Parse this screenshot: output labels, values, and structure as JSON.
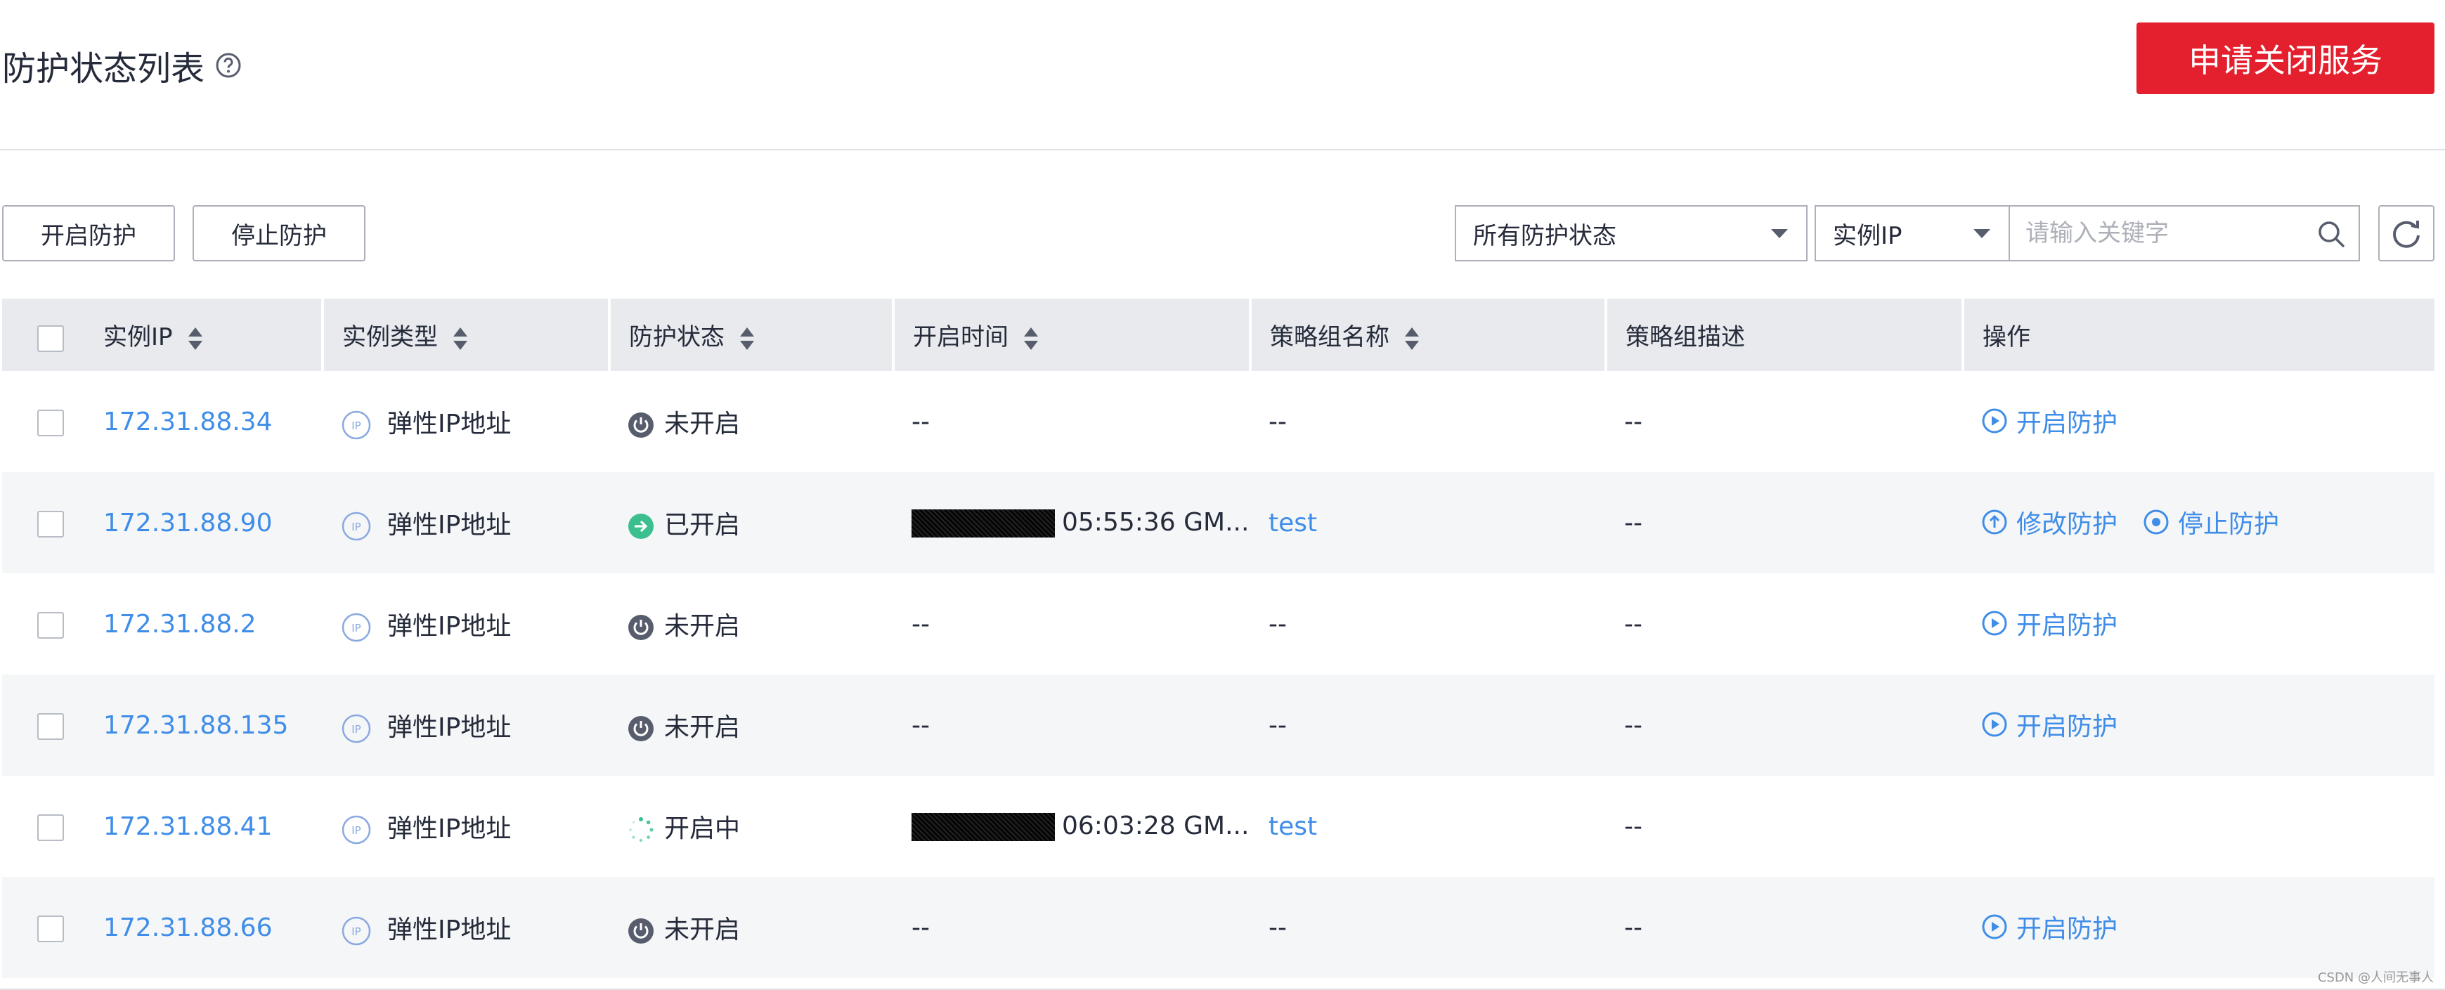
{
  "header": {
    "title": "防护状态列表",
    "close_service_label": "申请关闭服务"
  },
  "toolbar": {
    "start_label": "开启防护",
    "stop_label": "停止防护",
    "status_filter": "所有防护状态",
    "search_field": "实例IP",
    "search_placeholder": "请输入关键字"
  },
  "table": {
    "columns": [
      "实例IP",
      "实例类型",
      "防护状态",
      "开启时间",
      "策略组名称",
      "策略组描述",
      "操作"
    ],
    "rows": [
      {
        "ip": "172.31.88.34",
        "type": "弹性IP地址",
        "status": "未开启",
        "status_kind": "off",
        "time": "--",
        "policy": "--",
        "desc": "--",
        "ops": [
          "开启防护"
        ]
      },
      {
        "ip": "172.31.88.90",
        "type": "弹性IP地址",
        "status": "已开启",
        "status_kind": "on",
        "time": "05:55:36 GM...",
        "policy": "test",
        "desc": "--",
        "ops": [
          "修改防护",
          "停止防护"
        ]
      },
      {
        "ip": "172.31.88.2",
        "type": "弹性IP地址",
        "status": "未开启",
        "status_kind": "off",
        "time": "--",
        "policy": "--",
        "desc": "--",
        "ops": [
          "开启防护"
        ]
      },
      {
        "ip": "172.31.88.135",
        "type": "弹性IP地址",
        "status": "未开启",
        "status_kind": "off",
        "time": "--",
        "policy": "--",
        "desc": "--",
        "ops": [
          "开启防护"
        ]
      },
      {
        "ip": "172.31.88.41",
        "type": "弹性IP地址",
        "status": "开启中",
        "status_kind": "loading",
        "time": "06:03:28 GM...",
        "policy": "test",
        "desc": "--",
        "ops": []
      },
      {
        "ip": "172.31.88.66",
        "type": "弹性IP地址",
        "status": "未开启",
        "status_kind": "off",
        "time": "--",
        "policy": "--",
        "desc": "--",
        "ops": [
          "开启防护"
        ]
      }
    ]
  },
  "watermark": "CSDN @人间无事人",
  "colors": {
    "accent": "#3f8de8",
    "danger": "#e5202e",
    "on": "#3bbf8f",
    "off": "#575d6c"
  }
}
